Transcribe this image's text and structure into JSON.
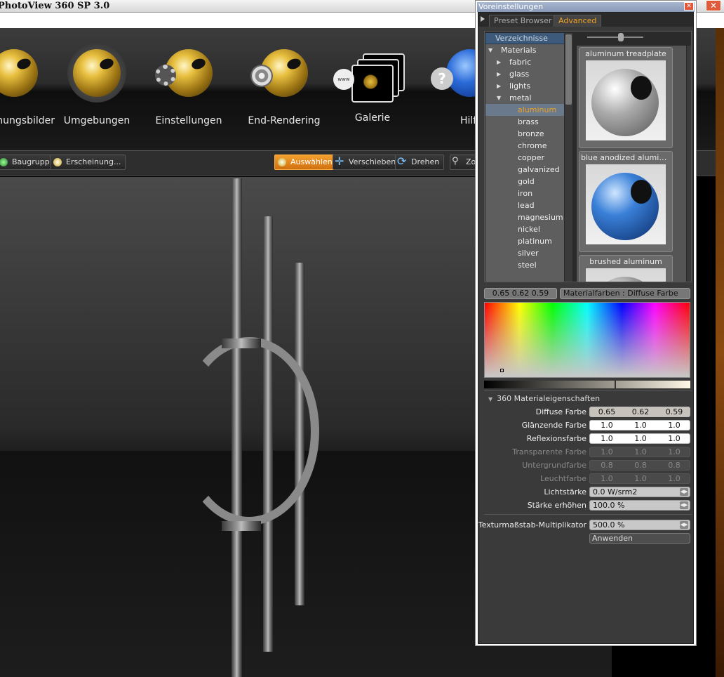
{
  "app": {
    "title": "PhotoView 360 SP 3.0",
    "close_symbol": "✕"
  },
  "toolbar": {
    "items": [
      {
        "label": "hungsbilder"
      },
      {
        "label": "Umgebungen"
      },
      {
        "label": "Einstellungen"
      },
      {
        "label": "End-Rendering"
      },
      {
        "label": "Galerie",
        "badge": "www"
      },
      {
        "label": "Hilf",
        "badge": "?"
      }
    ]
  },
  "subtoolbar": {
    "baugruppe": "Baugruppe",
    "erscheinung": "Erscheinung...",
    "auswaehlen": "Auswählen",
    "verschieben": "Verschieben",
    "drehen": "Drehen",
    "zoom": "Zo"
  },
  "dialog": {
    "title": "Voreinstellungen",
    "close_symbol": "✕",
    "tabs": [
      "Preset Browser",
      "Advanced"
    ],
    "active_tab": "Advanced",
    "tree": {
      "header": "Verzeichnisse",
      "root": "Materials",
      "folders": [
        "fabric",
        "glass",
        "lights",
        "metal"
      ],
      "metal_items": [
        "aluminum",
        "brass",
        "bronze",
        "chrome",
        "copper",
        "galvanized",
        "gold",
        "iron",
        "lead",
        "magnesium",
        "nickel",
        "platinum",
        "silver",
        "steel"
      ],
      "selected": "aluminum"
    },
    "thumbnails": [
      {
        "name": "aluminum treadplate"
      },
      {
        "name": "blue anodized aluminum"
      },
      {
        "name": "brushed aluminum"
      }
    ],
    "color": {
      "value": "0.65 0.62 0.59",
      "name": "Materialfarben : Diffuse Farbe"
    },
    "section": "360 Materialeigenschaften",
    "colors": {
      "accent": "#f0a020",
      "tree_bg": "#5e5e5e",
      "panel_bg": "#3a3a3a"
    },
    "properties": [
      {
        "label": "Diffuse Farbe",
        "v": [
          "0.65",
          "0.62",
          "0.59"
        ]
      },
      {
        "label": "Glänzende Farbe",
        "v": [
          "1.0",
          "1.0",
          "1.0"
        ]
      },
      {
        "label": "Reflexionsfarbe",
        "v": [
          "1.0",
          "1.0",
          "1.0"
        ]
      },
      {
        "label": "Transparente Farbe",
        "v": [
          "1.0",
          "1.0",
          "1.0"
        ]
      },
      {
        "label": "Untergrundfarbe",
        "v": [
          "0.8",
          "0.8",
          "0.8"
        ]
      },
      {
        "label": "Leuchtfarbe",
        "v": [
          "1.0",
          "1.0",
          "1.0"
        ]
      }
    ],
    "lichtstaerke": {
      "label": "Lichtstärke",
      "value": "0.0 W/srm2"
    },
    "staerke": {
      "label": "Stärke erhöhen",
      "value": "100.0 %"
    },
    "textur": {
      "label": "Texturmaßstab-Multiplikator",
      "value": "500.0 %"
    },
    "apply": "Anwenden"
  }
}
